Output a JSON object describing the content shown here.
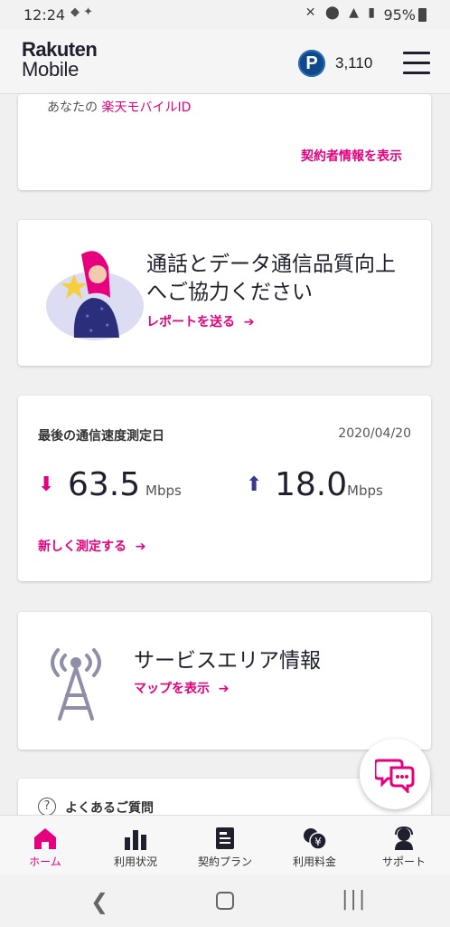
{
  "status_bar": {
    "time": "12:24",
    "battery": "95%"
  },
  "header": {
    "logo_line1": "Rakuten",
    "logo_line2": "Mobile",
    "points_symbol": "P",
    "points_value": "3,110"
  },
  "account_card": {
    "id_prefix": "あなたの",
    "id_link": "楽天モバイルID",
    "contract_link": "契約者情報を表示"
  },
  "quality_card": {
    "title_line1": "通話とデータ通信品質向上",
    "title_line2": "へご協力ください",
    "report_link": "レポートを送る"
  },
  "speed_card": {
    "label": "最後の通信速度測定日",
    "date": "2020/04/20",
    "download_value": "63.5",
    "upload_value": "18.0",
    "unit": "Mbps",
    "measure_link": "新しく測定する"
  },
  "area_card": {
    "title": "サービスエリア情報",
    "map_link": "マップを表示"
  },
  "faq_card": {
    "icon_glyph": "?",
    "label": "よくあるご質問"
  },
  "bottom_nav": {
    "items": [
      {
        "label": "ホーム",
        "icon": "home-icon",
        "active": true
      },
      {
        "label": "利用状況",
        "icon": "bar-chart-icon",
        "active": false
      },
      {
        "label": "契約プラン",
        "icon": "contract-doc-icon",
        "active": false
      },
      {
        "label": "利用料金",
        "icon": "yen-coins-icon",
        "active": false
      },
      {
        "label": "サポート",
        "icon": "headset-user-icon",
        "active": false
      }
    ]
  },
  "colors": {
    "accent": "#e6007e",
    "navy": "#1f1f2e",
    "points_blue": "#0e4a8a"
  }
}
